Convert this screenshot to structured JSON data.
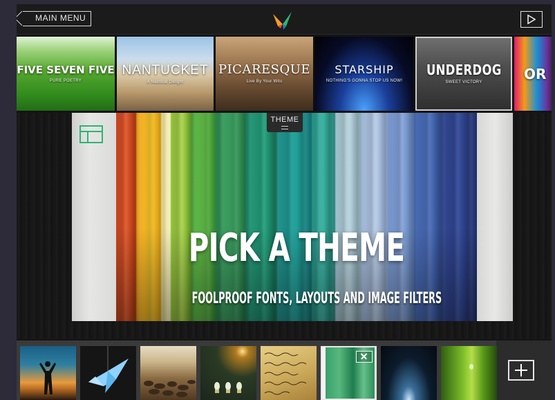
{
  "header": {
    "main_menu_label": "MAIN MENU",
    "logo_icon": "bird-logo-icon",
    "play_icon": "play-icon"
  },
  "themes": [
    {
      "title": "FIVE SEVEN FIVE",
      "subtitle": "PURE POETRY"
    },
    {
      "title": "NANTUCKET",
      "subtitle": "A Nautical Delight"
    },
    {
      "title": "PICARESQUE",
      "subtitle": "Live By Your Wits"
    },
    {
      "title": "STARSHIP",
      "subtitle": "NOTHING'S GONNA STOP US NOW!"
    },
    {
      "title": "UNDERDOG",
      "subtitle": "SWEET VICTORY",
      "selected": true
    },
    {
      "title": "OR",
      "subtitle": ""
    }
  ],
  "preview": {
    "tab_label": "THEME",
    "title": "PICK A THEME",
    "subtitle": "FOOLPROOF FONTS, LAYOUTS AND IMAGE FILTERS",
    "layout_icon": "layout-icon",
    "accent_color": "#2bb673"
  },
  "photos": [
    {
      "name": "silhouette-sunset"
    },
    {
      "name": "paper-crane"
    },
    {
      "name": "wildebeest-herd"
    },
    {
      "name": "glowing-bulbs"
    },
    {
      "name": "handwritten-letter"
    },
    {
      "name": "green-shirts",
      "selected": true
    },
    {
      "name": "blue-spotlight"
    },
    {
      "name": "green-grass-drop"
    }
  ],
  "icons": {
    "remove": "close-icon",
    "add": "plus-icon"
  }
}
